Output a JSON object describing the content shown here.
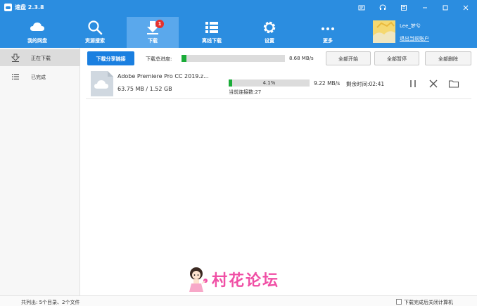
{
  "app": {
    "title": "速盘 2.3.8"
  },
  "nav": [
    {
      "label": "我的网盘",
      "icon": "cloud-icon"
    },
    {
      "label": "资源搜索",
      "icon": "search-icon"
    },
    {
      "label": "下载",
      "icon": "download-icon",
      "badge": "1"
    },
    {
      "label": "离线下载",
      "icon": "list-icon"
    },
    {
      "label": "设置",
      "icon": "gear-icon"
    },
    {
      "label": "更多",
      "icon": "more-icon"
    }
  ],
  "user": {
    "name": "Lee_梦兮",
    "logout_label": "退出当前账户"
  },
  "sidebar": [
    {
      "label": "正在下载",
      "icon": "downloading-icon"
    },
    {
      "label": "已完成",
      "icon": "completed-list-icon"
    }
  ],
  "toolbar": {
    "share_label": "下载分享链接",
    "progress_label": "下载总进度:",
    "total_progress": 0.05,
    "total_speed": "8.68 MB/s",
    "start_all": "全部开始",
    "pause_all": "全部暂停",
    "delete_all": "全部删除"
  },
  "downloads": [
    {
      "name": "Adobe Premiere Pro CC 2019.z...",
      "size": "63.75 MB / 1.52 GB",
      "percent": "4.1%",
      "progress": 0.041,
      "connections": "当前连接数:27",
      "speed": "9.22 MB/s",
      "remaining": "剩余时间:02:41"
    }
  ],
  "watermark": {
    "text": "村花论坛"
  },
  "status": {
    "summary": "共列出: 5个目录、2个文件",
    "shutdown_label": "下载完成后关闭计算机"
  },
  "colors": {
    "accent": "#2b8de0",
    "progress": "#1aac38",
    "badge": "#e5312d",
    "watermark": "#f04fa5"
  }
}
